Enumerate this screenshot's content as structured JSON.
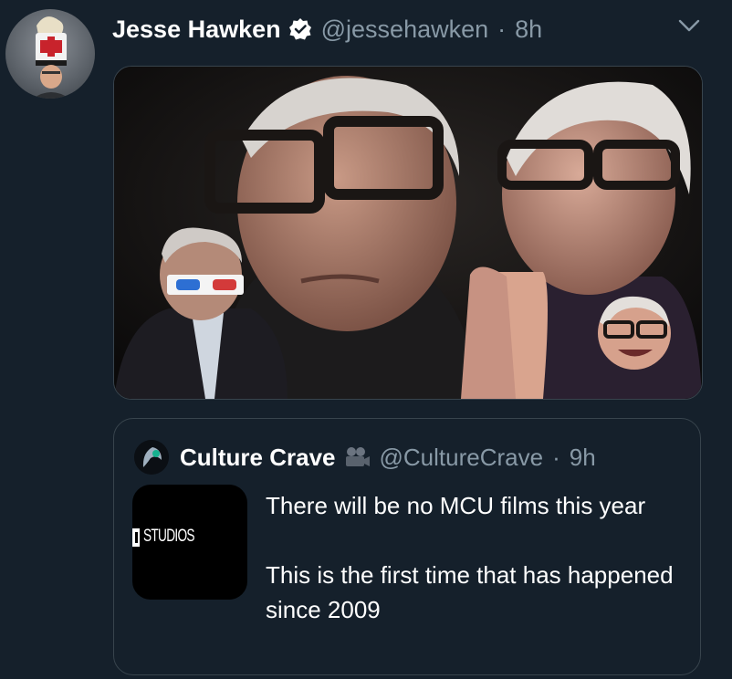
{
  "tweet": {
    "author_name": "Jesse Hawken",
    "author_handle": "@jessehawken",
    "time": "8h",
    "separator": "·"
  },
  "quoted_tweet": {
    "author_name": "Culture Crave",
    "author_handle": "@CultureCrave",
    "time": "9h",
    "separator": "·",
    "thumbnail_text": "STUDIOS",
    "paragraphs": [
      "There will be no MCU films this year",
      "This is the first time that has happened since 2009"
    ]
  },
  "icons": {
    "verified": "verified-badge-icon",
    "caret": "chevron-down-icon",
    "camera": "movie-camera-emoji"
  },
  "colors": {
    "background": "#15202b",
    "secondary_text": "#8899a6",
    "border": "#38444d",
    "primary_text": "#ffffff"
  }
}
